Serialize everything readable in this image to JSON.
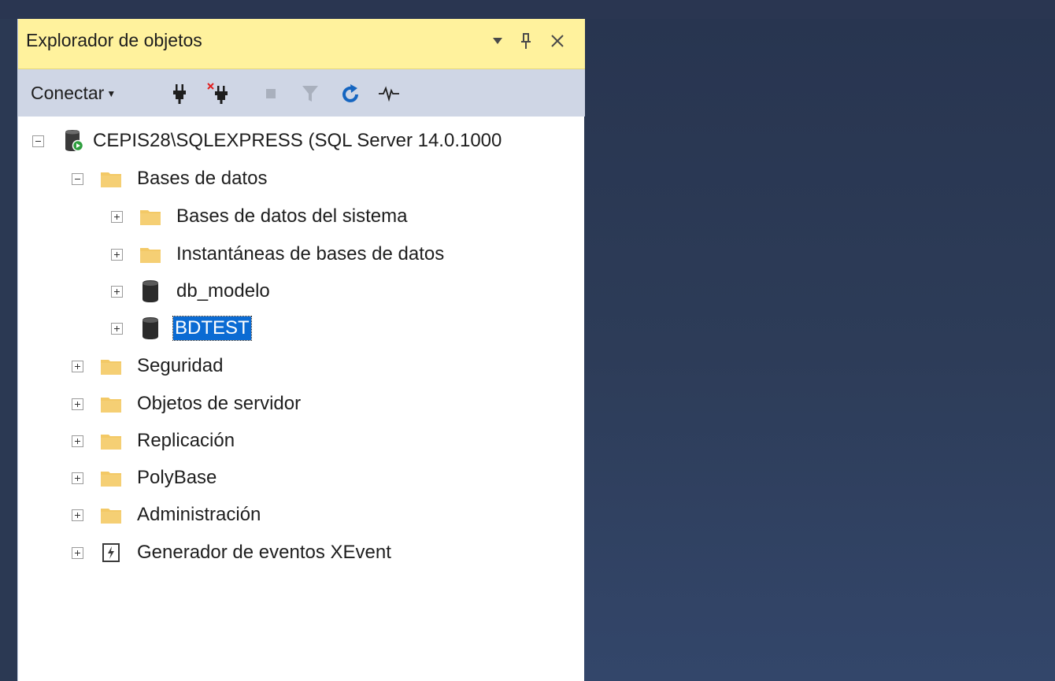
{
  "object_explorer": {
    "title": "Explorador de objetos",
    "title_buttons": {
      "dropdown_icon": "triangle-down-icon",
      "pin_icon": "pin-icon",
      "close_icon": "close-icon"
    },
    "toolbar": {
      "connect_label": "Conectar",
      "icons": [
        "plug-icon",
        "disconnect-icon",
        "stop-icon",
        "filter-icon",
        "refresh-icon",
        "activity-monitor-icon"
      ]
    },
    "tree": [
      {
        "label": "CEPIS28\\SQLEXPRESS (SQL Server 14.0.1000",
        "icon": "server-icon",
        "expanded": true,
        "level": 0
      },
      {
        "label": "Bases de datos",
        "icon": "folder-icon",
        "expanded": true,
        "level": 1
      },
      {
        "label": "Bases de datos del sistema",
        "icon": "folder-icon",
        "expanded": false,
        "level": 2
      },
      {
        "label": "Instantáneas de bases de datos",
        "icon": "folder-icon",
        "expanded": false,
        "level": 2
      },
      {
        "label": "db_modelo",
        "icon": "database-icon",
        "expanded": false,
        "level": 2
      },
      {
        "label": "BDTEST",
        "icon": "database-icon",
        "expanded": false,
        "level": 2,
        "selected": true
      },
      {
        "label": "Seguridad",
        "icon": "folder-icon",
        "expanded": false,
        "level": 1
      },
      {
        "label": "Objetos de servidor",
        "icon": "folder-icon",
        "expanded": false,
        "level": 1
      },
      {
        "label": "Replicación",
        "icon": "folder-icon",
        "expanded": false,
        "level": 1
      },
      {
        "label": "PolyBase",
        "icon": "folder-icon",
        "expanded": false,
        "level": 1
      },
      {
        "label": "Administración",
        "icon": "folder-icon",
        "expanded": false,
        "level": 1
      },
      {
        "label": "Generador de eventos XEvent",
        "icon": "xevent-icon",
        "expanded": false,
        "level": 1
      }
    ],
    "colors": {
      "title_bar": "#fff29d",
      "toolbar": "#cfd6e5",
      "selection": "#0b6bd3",
      "background": "#2c3b56",
      "folder": "#f3c966"
    }
  }
}
